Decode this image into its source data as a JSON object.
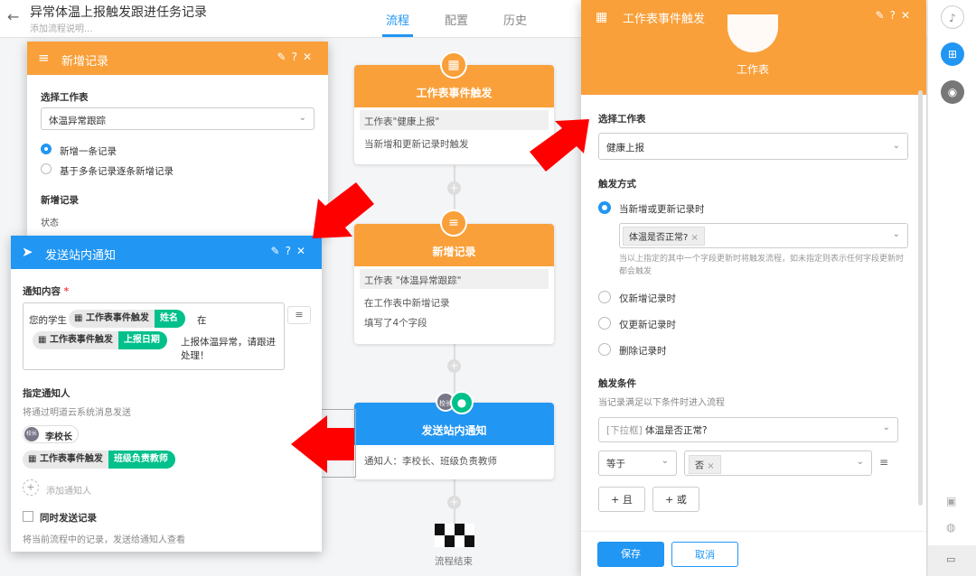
{
  "header": {
    "title": "异常体温上报触发跟进任务记录",
    "subtitle": "添加流程说明...",
    "tabs": [
      "流程",
      "配置",
      "历史"
    ]
  },
  "flow": {
    "trigger": {
      "title": "工作表事件触发",
      "row1": "工作表\"健康上报\"",
      "row2": "当新增和更新记录时触发"
    },
    "add": {
      "title": "新增记录",
      "row1": "工作表 \"体温异常跟踪\"",
      "row2": "在工作表中新增记录",
      "row3": "填写了4个字段"
    },
    "notify": {
      "title": "发送站内通知",
      "row1": "通知人：李校长、班级负责教师",
      "badge": "校长"
    },
    "end": "流程结束"
  },
  "add_panel": {
    "title": "新增记录",
    "select_sheet_label": "选择工作表",
    "sheet": "体温异常跟踪",
    "opt1": "新增一条记录",
    "opt2": "基于多条记录逐条新增记录",
    "new_record": "新增记录",
    "status": "状态"
  },
  "notify_panel": {
    "title": "发送站内通知",
    "content_label": "通知内容",
    "required": "*",
    "t1": "您的学生",
    "tok1a": "工作表事件触发",
    "tok1b": "姓名",
    "t2": "在",
    "tok2a": "工作表事件触发",
    "tok2b": "上报日期",
    "t3": "上报体温异常，请跟进处理！",
    "assign_label": "指定通知人",
    "assign_sub": "将通过明道云系统消息发送",
    "user1": "李校长",
    "user1_avatar": "校长",
    "tok3a": "工作表事件触发",
    "tok3b": "班级负责教师",
    "add_user": "添加通知人",
    "sync_label": "同时发送记录",
    "sync_sub": "将当前流程中的记录，发送给通知人查看"
  },
  "trigger_panel": {
    "title": "工作表事件触发",
    "sheet_icon_label": "工作表",
    "select_sheet_label": "选择工作表",
    "sheet": "健康上报",
    "mode_label": "触发方式",
    "mode1": "当新增或更新记录时",
    "field_tag": "体温是否正常?",
    "hint": "当以上指定的其中一个字段更新时将触发流程，如未指定则表示任何字段更新时都会触发",
    "mode2": "仅新增记录时",
    "mode3": "仅更新记录时",
    "mode4": "删除记录时",
    "cond_label": "触发条件",
    "cond_sub": "当记录满足以下条件时进入流程",
    "cond_field_prefix": "[下拉框]",
    "cond_field": "体温是否正常?",
    "op": "等于",
    "val": "否",
    "and": "+ 且",
    "or": "+ 或",
    "save": "保存",
    "cancel": "取消"
  },
  "colors": {
    "orange": "#f9a03a",
    "blue": "#2196f3",
    "green": "#00c08b",
    "red": "#ff0000"
  }
}
